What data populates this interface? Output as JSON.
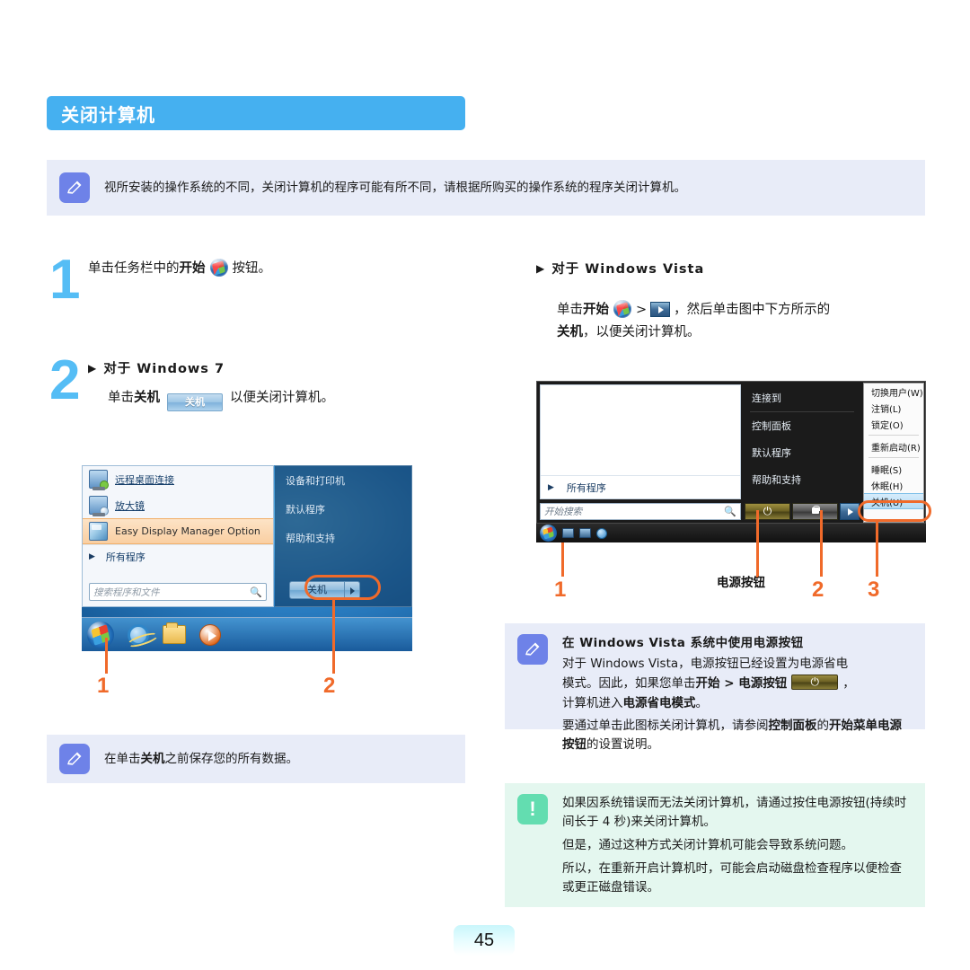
{
  "section": {
    "title": "关闭计算机"
  },
  "notes": {
    "top": {
      "text": "视所安装的操作系统的不同，关闭计算机的程序可能有所不同，请根据所购买的操作系统的程序关闭计算机。",
      "icon": "note-pencil-icon"
    },
    "left_bottom": {
      "prefix": "在单击",
      "bold": "关机",
      "suffix": "之前保存您的所有数据。",
      "icon": "note-pencil-icon"
    },
    "vista_power": {
      "title": "在 Windows Vista 系统中使用电源按钮",
      "line1_a": "对于 Windows Vista，电源按钮已经设置为电源省电",
      "line1_b": "模式。因此，如果您单击",
      "line1_bold1": "开始 > 电源按钮",
      "line1_c": "，",
      "line2_a": "计算机进入",
      "line2_bold": "电源省电模式",
      "line2_b": "。",
      "line3_a": "要通过单击此图标关闭计算机，请参阅",
      "line3_bold1": "控制面板",
      "line3_b": "的",
      "line3_bold2": "开始菜单电源按钮",
      "line3_c": "的设置说明。",
      "icon": "note-pencil-icon"
    },
    "caution": {
      "para1": "如果因系统错误而无法关闭计算机，请通过按住电源按钮(持续时间长于 4 秒)来关闭计算机。",
      "para2": "但是，通过这种方式关闭计算机可能会导致系统问题。",
      "para3": "所以，在重新开启计算机时，可能会启动磁盘检查程序以便检查或更正磁盘错误。",
      "icon": "caution-exclamation-icon"
    }
  },
  "steps": {
    "one": {
      "number": "1",
      "text_a": "单击任务栏中的",
      "text_bold": "开始",
      "text_b": "按钮。",
      "icon": "windows-orb-icon"
    },
    "two": {
      "number": "2",
      "heading": "对于 Windows 7",
      "text_a": "单击",
      "text_bold": "关机",
      "button_label": "关机",
      "text_b": "以便关闭计算机。"
    },
    "vista": {
      "heading": "对于 Windows Vista",
      "line1_a": "单击",
      "line1_bold": "开始",
      "line1_gt": ">",
      "line1_b": "，然后单击图中下方所示的",
      "line2_bold": "关机",
      "line2_b": "，以便关闭计算机。"
    }
  },
  "figure_win7": {
    "menu_items": [
      {
        "label": "远程桌面连接",
        "icon": "remote-desktop-icon",
        "highlighted": false
      },
      {
        "label": "放大镜",
        "icon": "magnifier-icon",
        "highlighted": false
      },
      {
        "label": "Easy Display Manager Option",
        "icon": "display-manager-icon",
        "highlighted": true
      }
    ],
    "all_programs": "所有程序",
    "search_placeholder": "搜索程序和文件",
    "right_items": [
      "设备和打印机",
      "默认程序",
      "帮助和支持"
    ],
    "shutdown_label": "关机",
    "taskbar_icons": [
      "start-orb-icon",
      "internet-explorer-icon",
      "explorer-folder-icon",
      "media-player-icon"
    ],
    "callouts": [
      {
        "number": "1"
      },
      {
        "number": "2"
      }
    ]
  },
  "figure_vista": {
    "all_programs": "所有程序",
    "search_placeholder": "开始搜索",
    "middle_items": [
      "连接到",
      "控制面板",
      "默认程序",
      "帮助和支持"
    ],
    "context_menu": [
      {
        "label": "切换用户(W)",
        "selected": false
      },
      {
        "label": "注销(L)",
        "selected": false
      },
      {
        "label": "锁定(O)",
        "selected": false
      },
      {
        "label": "重新启动(R)",
        "selected": false
      },
      {
        "label": "睡眠(S)",
        "selected": false
      },
      {
        "label": "休眠(H)",
        "selected": false
      },
      {
        "label": "关机(U)",
        "selected": true
      }
    ],
    "power_button_icon": "power-icon",
    "lock_button_icon": "lock-icon",
    "arrow_button_icon": "arrow-right-icon",
    "taskbar_icons": [
      "start-orb-icon",
      "show-desktop-icon",
      "switch-window-icon",
      "internet-explorer-icon"
    ],
    "callouts": [
      {
        "number": "1"
      },
      {
        "number": "2"
      },
      {
        "number": "3"
      }
    ],
    "power_label": "电源按钮"
  },
  "footer": {
    "page_number": "45"
  },
  "colors": {
    "header_blue": "#45b0f0",
    "step_number_blue": "#55bdf5",
    "callout_orange": "#f06a2a",
    "note_bg": "#e8ecf8",
    "note_icon": "#6e82e8",
    "caution_bg": "#e4f7ef",
    "caution_icon": "#63ddb0"
  }
}
